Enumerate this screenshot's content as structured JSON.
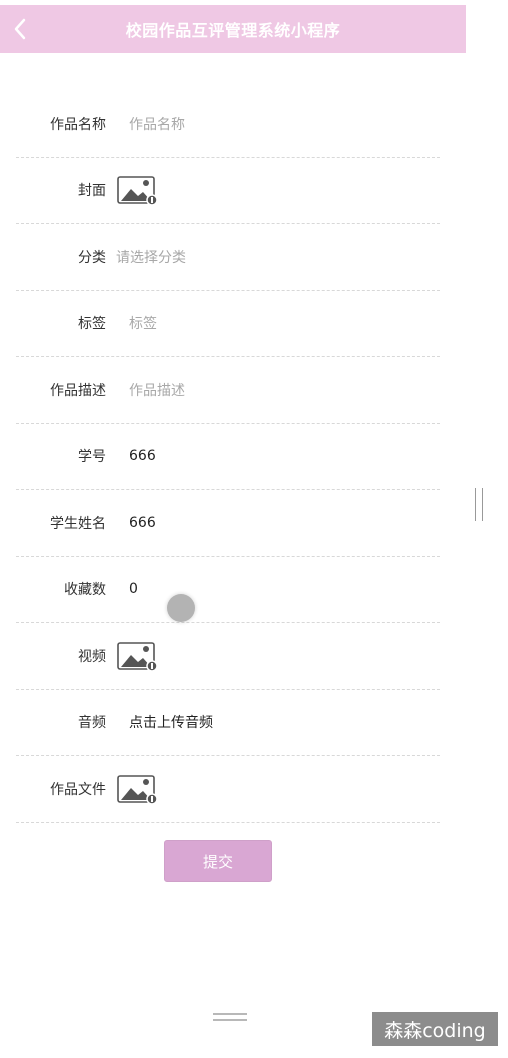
{
  "header": {
    "title": "校园作品互评管理系统小程序",
    "background": "#efc8e4",
    "back_icon": "chevron-left-icon"
  },
  "form": {
    "fields": [
      {
        "label": "作品名称",
        "value": "作品名称",
        "kind": "text-input",
        "is_placeholder": true
      },
      {
        "label": "封面",
        "value": "",
        "kind": "image-upload",
        "icon": "image-upload-icon"
      },
      {
        "label": "分类",
        "value": "请选择分类",
        "kind": "select",
        "is_placeholder": true
      },
      {
        "label": "标签",
        "value": "标签",
        "kind": "text-input",
        "is_placeholder": true
      },
      {
        "label": "作品描述",
        "value": "作品描述",
        "kind": "text-input",
        "is_placeholder": true
      },
      {
        "label": "学号",
        "value": "666",
        "kind": "text-input",
        "is_placeholder": false
      },
      {
        "label": "学生姓名",
        "value": "666",
        "kind": "text-input",
        "is_placeholder": false
      },
      {
        "label": "收藏数",
        "value": "0",
        "kind": "text-input",
        "is_placeholder": false
      },
      {
        "label": "视频",
        "value": "",
        "kind": "image-upload",
        "icon": "image-upload-icon"
      },
      {
        "label": "音频",
        "value": "点击上传音频",
        "kind": "upload-link",
        "is_placeholder": false
      },
      {
        "label": "作品文件",
        "value": "",
        "kind": "image-upload",
        "icon": "image-upload-icon"
      }
    ],
    "submit_label": "提交",
    "submit_color": "#d9a7d3"
  },
  "watermark": "森森coding"
}
